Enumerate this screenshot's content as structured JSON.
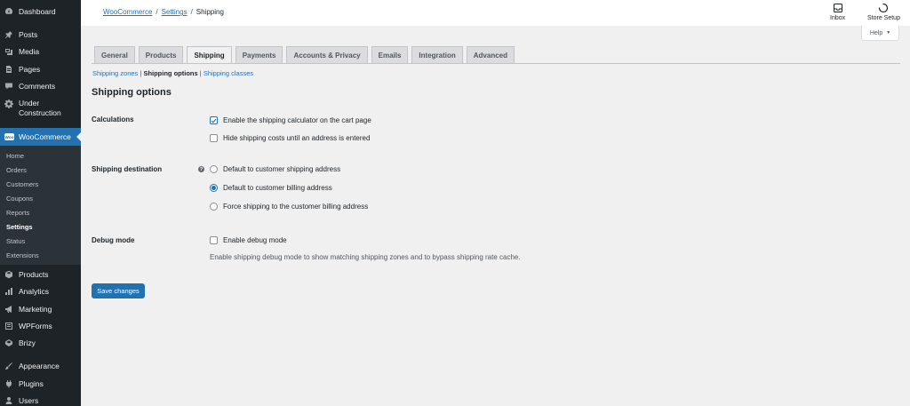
{
  "sidebar": {
    "items": [
      {
        "label": "Dashboard",
        "icon": "dashboard-icon"
      },
      {
        "label": "Posts",
        "icon": "pin-icon"
      },
      {
        "label": "Media",
        "icon": "media-icon"
      },
      {
        "label": "Pages",
        "icon": "page-icon"
      },
      {
        "label": "Comments",
        "icon": "comment-icon"
      },
      {
        "label": "Under Construction",
        "label_line1": "Under",
        "label_line2": "Construction",
        "icon": "gear-icon"
      },
      {
        "label": "WooCommerce",
        "icon": "woocommerce-icon",
        "badge": "Woo"
      },
      {
        "label": "Products",
        "icon": "box-icon"
      },
      {
        "label": "Analytics",
        "icon": "bar-chart-icon"
      },
      {
        "label": "Marketing",
        "icon": "megaphone-icon"
      },
      {
        "label": "WPForms",
        "icon": "form-icon"
      },
      {
        "label": "Brizy",
        "icon": "brizy-icon"
      },
      {
        "label": "Appearance",
        "icon": "brush-icon"
      },
      {
        "label": "Plugins",
        "icon": "plug-icon"
      },
      {
        "label": "Users",
        "icon": "user-icon"
      }
    ],
    "woocommerce_submenu": [
      {
        "label": "Home"
      },
      {
        "label": "Orders"
      },
      {
        "label": "Customers"
      },
      {
        "label": "Coupons"
      },
      {
        "label": "Reports"
      },
      {
        "label": "Settings",
        "current": true
      },
      {
        "label": "Status"
      },
      {
        "label": "Extensions"
      }
    ]
  },
  "header": {
    "breadcrumb": [
      {
        "label": "WooCommerce",
        "link": true
      },
      {
        "label": "Settings",
        "link": true
      },
      {
        "label": "Shipping",
        "link": false
      }
    ],
    "separator": "/",
    "actions": [
      {
        "label": "Inbox",
        "icon": "inbox-icon"
      },
      {
        "label": "Store Setup",
        "icon": "spinner-icon"
      }
    ],
    "help_label": "Help",
    "help_arrow": "▼"
  },
  "tabs": [
    {
      "label": "General"
    },
    {
      "label": "Products"
    },
    {
      "label": "Shipping",
      "active": true
    },
    {
      "label": "Payments"
    },
    {
      "label": "Accounts & Privacy"
    },
    {
      "label": "Emails"
    },
    {
      "label": "Integration"
    },
    {
      "label": "Advanced"
    }
  ],
  "subnav": {
    "items": [
      {
        "label": "Shipping zones",
        "current": false
      },
      {
        "label": "Shipping options",
        "current": true
      },
      {
        "label": "Shipping classes",
        "current": false
      }
    ],
    "separator": "|"
  },
  "section_title": "Shipping options",
  "calculations": {
    "label": "Calculations",
    "options": [
      {
        "label": "Enable the shipping calculator on the cart page",
        "checked": true
      },
      {
        "label": "Hide shipping costs until an address is entered",
        "checked": false
      }
    ]
  },
  "shipping_destination": {
    "label": "Shipping destination",
    "help": "?",
    "options": [
      {
        "label": "Default to customer shipping address",
        "selected": false
      },
      {
        "label": "Default to customer billing address",
        "selected": true
      },
      {
        "label": "Force shipping to the customer billing address",
        "selected": false
      }
    ]
  },
  "debug_mode": {
    "label": "Debug mode",
    "option": {
      "label": "Enable debug mode",
      "checked": false
    },
    "description": "Enable shipping debug mode to show matching shipping zones and to bypass shipping rate cache."
  },
  "save_button": "Save changes",
  "colors": {
    "sidebar_bg": "#1d2327",
    "submenu_bg": "#2c3338",
    "accent": "#2271b1",
    "page_bg": "#f0f0f1"
  }
}
